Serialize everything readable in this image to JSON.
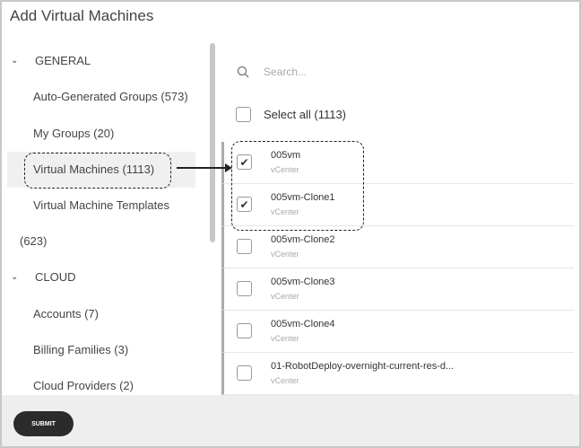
{
  "dialog": {
    "title": "Add Virtual Machines"
  },
  "sidebar": {
    "sections": [
      {
        "label": "GENERAL"
      },
      {
        "label": "CLOUD"
      }
    ],
    "items": [
      {
        "label": "Auto-Generated Groups (573)"
      },
      {
        "label": "My Groups (20)"
      },
      {
        "label": "Virtual Machines (1113)",
        "selected": true
      },
      {
        "label": "Virtual Machine Templates"
      },
      {
        "label": "(623)"
      },
      {
        "label": "Accounts (7)"
      },
      {
        "label": "Billing Families (3)"
      },
      {
        "label": "Cloud Providers (2)"
      }
    ]
  },
  "search": {
    "placeholder": "Search..."
  },
  "select_all": {
    "label": "Select all (1113)",
    "checked": false
  },
  "vms": [
    {
      "name": "005vm",
      "source": "vCenter",
      "checked": true
    },
    {
      "name": "005vm-Clone1",
      "source": "vCenter",
      "checked": true
    },
    {
      "name": "005vm-Clone2",
      "source": "vCenter",
      "checked": false
    },
    {
      "name": "005vm-Clone3",
      "source": "vCenter",
      "checked": false
    },
    {
      "name": "005vm-Clone4",
      "source": "vCenter",
      "checked": false
    },
    {
      "name": "01-RobotDeploy-overnight-current-res-d...",
      "source": "vCenter",
      "checked": false
    }
  ],
  "footer": {
    "submit_label": "SUBMIT"
  }
}
